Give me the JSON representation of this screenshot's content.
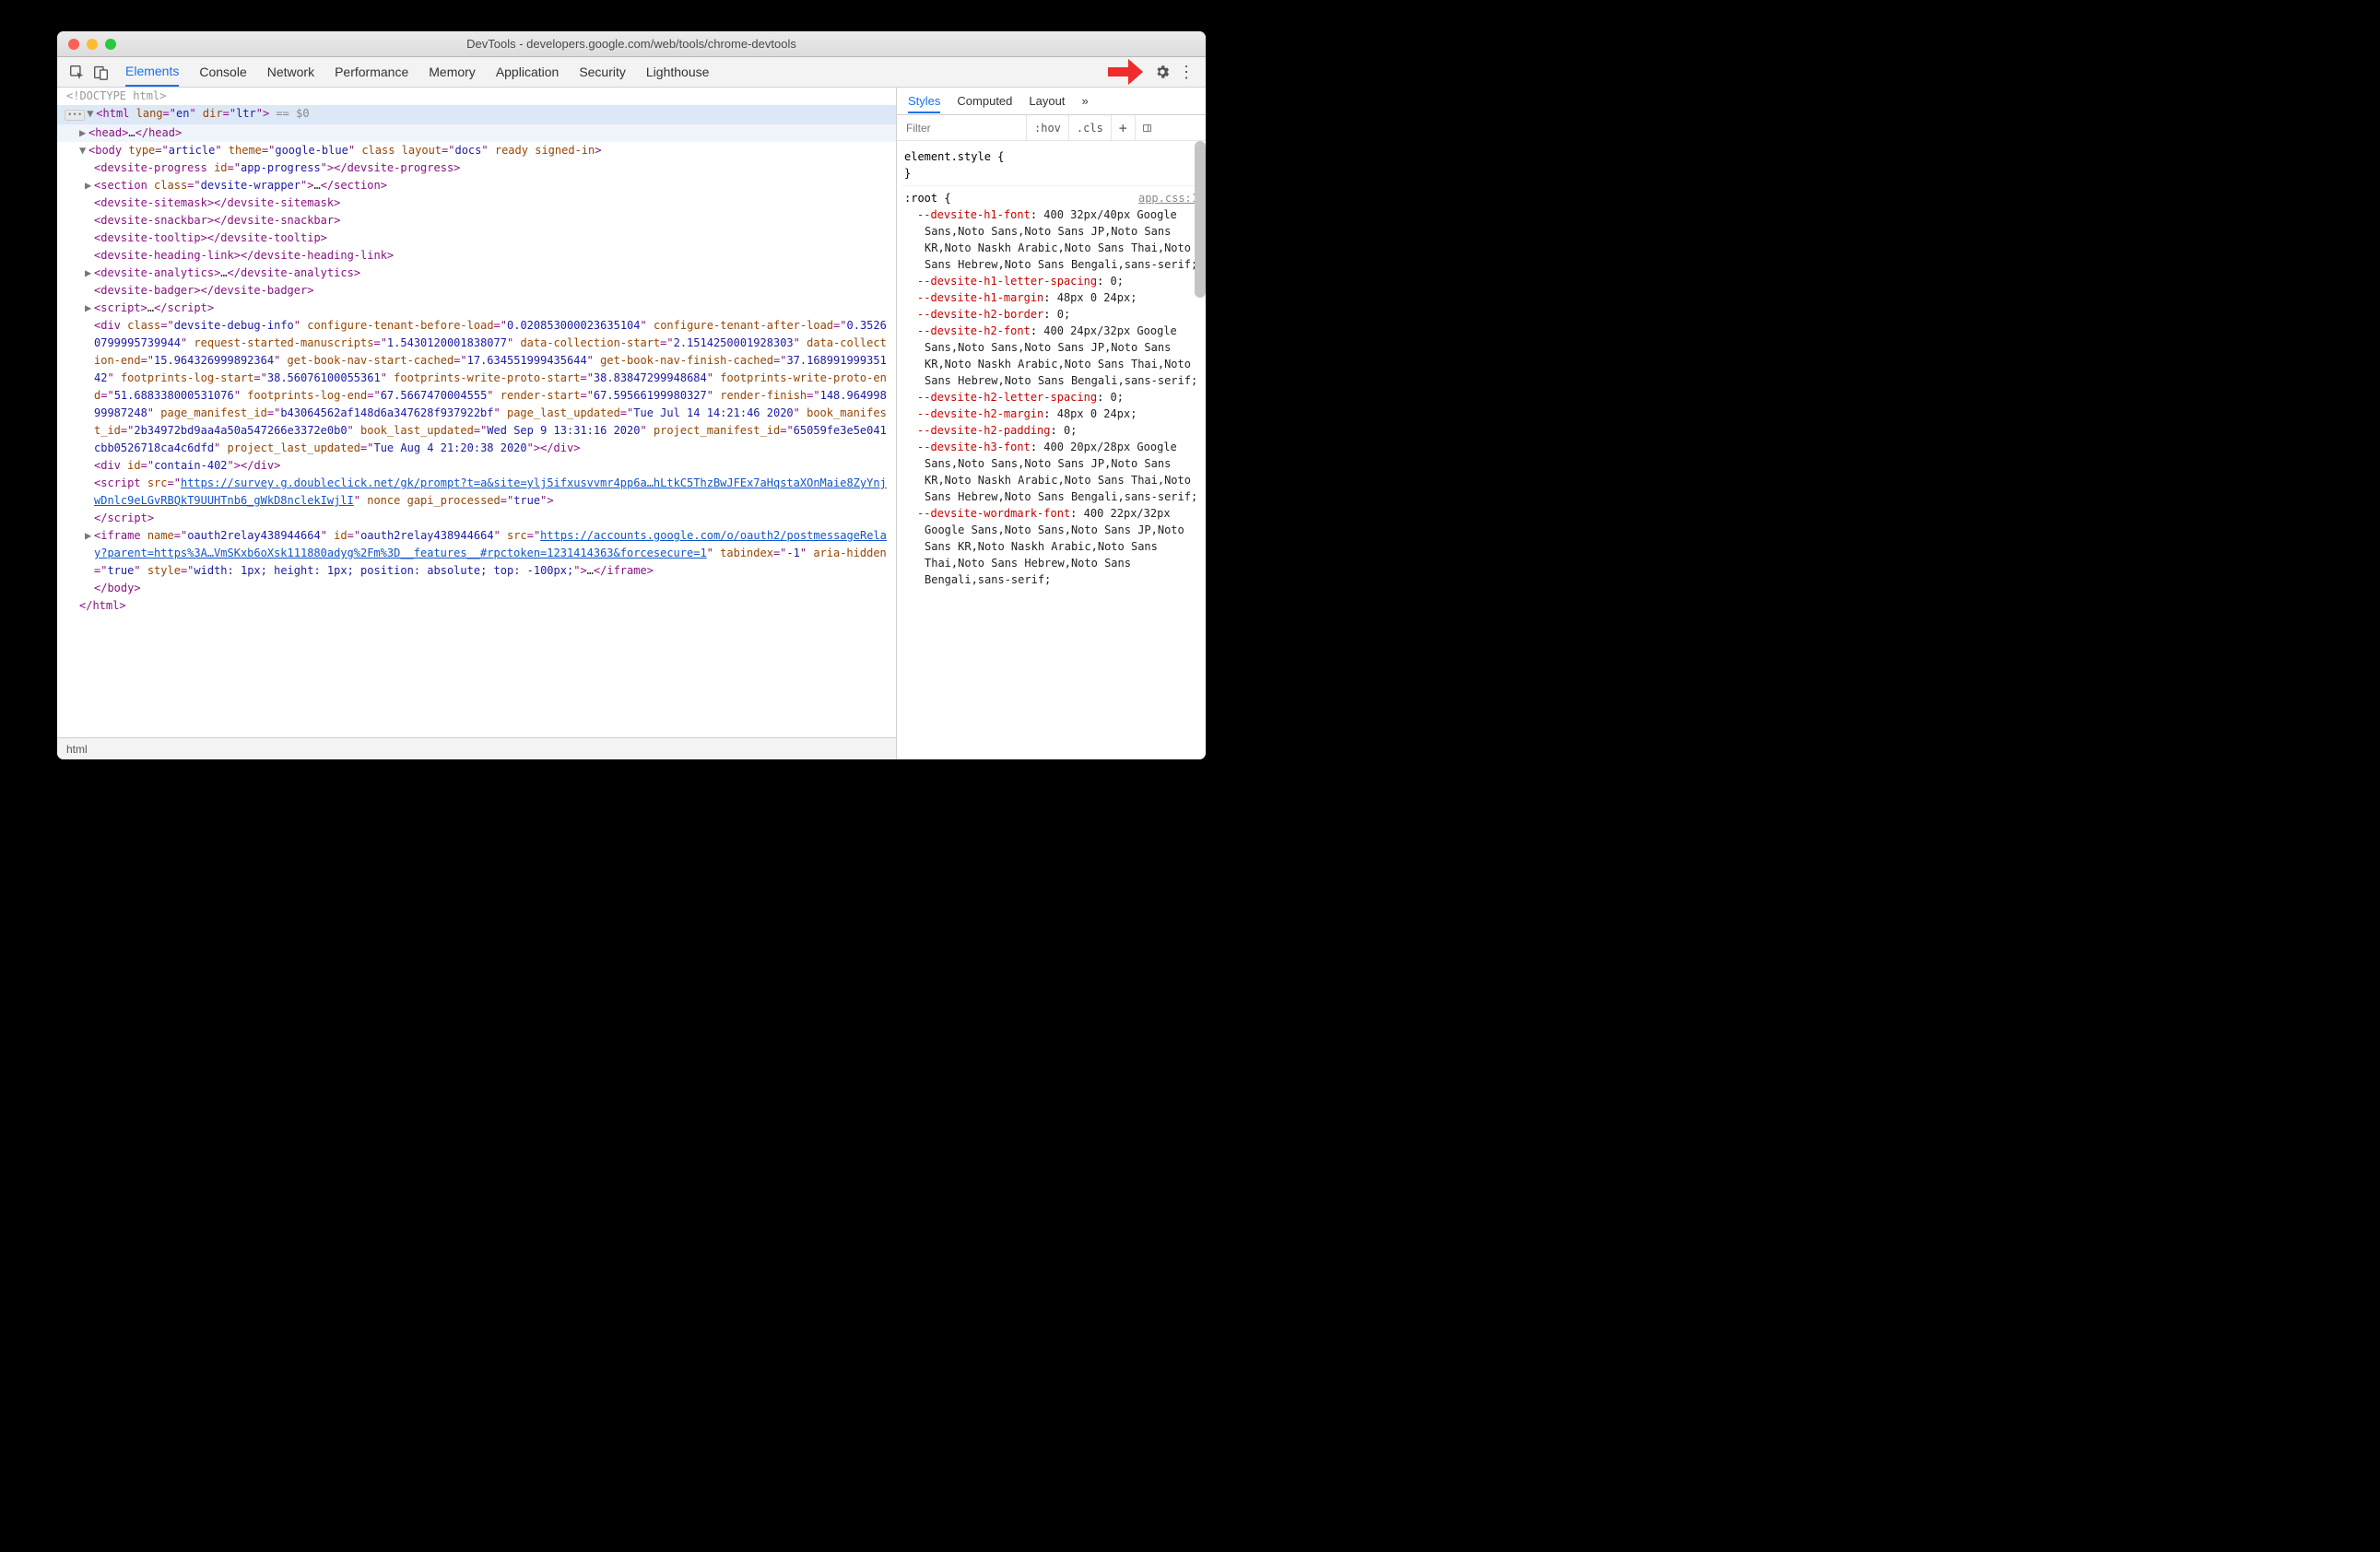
{
  "window": {
    "title": "DevTools - developers.google.com/web/tools/chrome-devtools"
  },
  "tabs": [
    "Elements",
    "Console",
    "Network",
    "Performance",
    "Memory",
    "Application",
    "Security",
    "Lighthouse"
  ],
  "breadcrumb": "html",
  "dom": {
    "doctype": "<!DOCTYPE html>",
    "html_open": "<html lang=\"en\" dir=\"ltr\">",
    "sel0": " == $0",
    "head": {
      "open": "<head>",
      "ell": "…",
      "close": "</head>"
    },
    "body_attrs": "type=\"article\" theme=\"google-blue\" class layout=\"docs\" ready signed-in",
    "progress": {
      "open": "<devsite-progress id=\"app-progress\">",
      "close": "</devsite-progress>"
    },
    "section": {
      "open": "<section class=\"devsite-wrapper\">",
      "ell": "…",
      "close": "</section>"
    },
    "sitemask": "<devsite-sitemask></devsite-sitemask>",
    "snackbar": "<devsite-snackbar></devsite-snackbar>",
    "tooltip": "<devsite-tooltip></devsite-tooltip>",
    "heading": "<devsite-heading-link></devsite-heading-link>",
    "analytics": {
      "open": "<devsite-analytics>",
      "ell": "…",
      "close": "</devsite-analytics>"
    },
    "badger": "<devsite-badger></devsite-badger>",
    "script1": {
      "open": "<script>",
      "ell": "…",
      "close": "</script>"
    },
    "debugdiv": {
      "l1": "<div class=\"devsite-debug-info\" configure-tenant-before-load=\"0.020853000023635104\" configure-",
      "l2": "tenant-after-load=\"0.35260799995739944\" request-started-manuscripts=\"1.5430120001838077\" data-",
      "l3": "collection-start=\"2.1514250001928303\" data-collection-end=\"15.964326999892364\" get-book-nav-",
      "l4": "start-cached=\"17.634551999435644\" get-book-nav-finish-cached=\"37.16899199935142\" footprints-log-",
      "l5": "start=\"38.56076100055361\" footprints-write-proto-start=\"38.83847299948684\" footprints-write-",
      "l6": "proto-end=\"51.688338000531076\" footprints-log-end=\"67.5667470004555\" render-start=\"67.59566199980",
      "l7": "327\" render-finish=\"148.96499899987248\" page_manifest_id=\"b43064562af148d6a347628f937922bf\"",
      "l8": "page_last_updated=\"Tue Jul 14 14:21:46 2020\" book_manifest_id=\"2b34972bd9aa4a50a547266e3372e0b0\"",
      "l9": "book_last_updated=\"Wed Sep  9 13:31:16 2020\" project_manifest_id=\"65059fe3e5e041cbb0526718ca4c6df",
      "l10": "d\" project_last_updated=\"Tue Aug  4 21:20:38 2020\"></div>"
    },
    "contain": "<div id=\"contain-402\"></div>",
    "script2": {
      "pre": "<script src=\"",
      "url1": "https://survey.g.doubleclick.net/gk/prompt?t=a&site=ylj5ifxusvvmr4pp6a…hLtkC5ThzBwJF",
      "url2": "Ex7aHqstaXOnMaie8ZyYnjwDnlc9eLGvRBQkT9UUHTnb6_gWkD8nclekIwjlI",
      "post": "\" nonce gapi_processed=\"true\">",
      "close": "</script>"
    },
    "iframe": {
      "pre": "<iframe name=\"oauth2relay438944664\" id=\"oauth2relay438944664\" src=\"",
      "url1": "https://accounts.google.com/o/",
      "url2": "oauth2/postmessageRelay?parent=https%3A…VmSKxb6oXsk111880adyg%2Fm%3D__features__#rpctoken=1231414363&forcesecure=1",
      "post": "\" tabindex=\"-1\" aria-hidden=\"true\" style=\"width: 1px; height: 1px; position: absolut",
      "post2": "e; top: -100px;\">",
      "ell": "…",
      "close": "</iframe>"
    },
    "body_close": "</body>",
    "html_close": "</html>"
  },
  "styles": {
    "tabs": [
      "Styles",
      "Computed",
      "Layout"
    ],
    "filter_placeholder": "Filter",
    "hov": ":hov",
    "cls": ".cls",
    "element_style": "element.style {",
    "brace_close": "}",
    "root": ":root {",
    "applink": "app.css:1",
    "props": [
      {
        "n": "--devsite-h1-font",
        "v": "400 32px/40px Google Sans,Noto Sans,Noto Sans JP,Noto Sans KR,Noto Naskh Arabic,Noto Sans Thai,Noto Sans Hebrew,Noto Sans Bengali,sans-serif;"
      },
      {
        "n": "--devsite-h1-letter-spacing",
        "v": "0;"
      },
      {
        "n": "--devsite-h1-margin",
        "v": "48px 0 24px;"
      },
      {
        "n": "--devsite-h2-border",
        "v": "0;"
      },
      {
        "n": "--devsite-h2-font",
        "v": "400 24px/32px Google Sans,Noto Sans,Noto Sans JP,Noto Sans KR,Noto Naskh Arabic,Noto Sans Thai,Noto Sans Hebrew,Noto Sans Bengali,sans-serif;"
      },
      {
        "n": "--devsite-h2-letter-spacing",
        "v": "0;"
      },
      {
        "n": "--devsite-h2-margin",
        "v": "48px 0 24px;"
      },
      {
        "n": "--devsite-h2-padding",
        "v": "0;"
      },
      {
        "n": "--devsite-h3-font",
        "v": "400 20px/28px Google Sans,Noto Sans,Noto Sans JP,Noto Sans KR,Noto Naskh Arabic,Noto Sans Thai,Noto Sans Hebrew,Noto Sans Bengali,sans-serif;"
      },
      {
        "n": "--devsite-wordmark-font",
        "v": "400 22px/32px Google Sans,Noto Sans,Noto Sans JP,Noto Sans KR,Noto Naskh Arabic,Noto Sans Thai,Noto Sans Hebrew,Noto Sans Bengali,sans-serif;"
      }
    ]
  }
}
